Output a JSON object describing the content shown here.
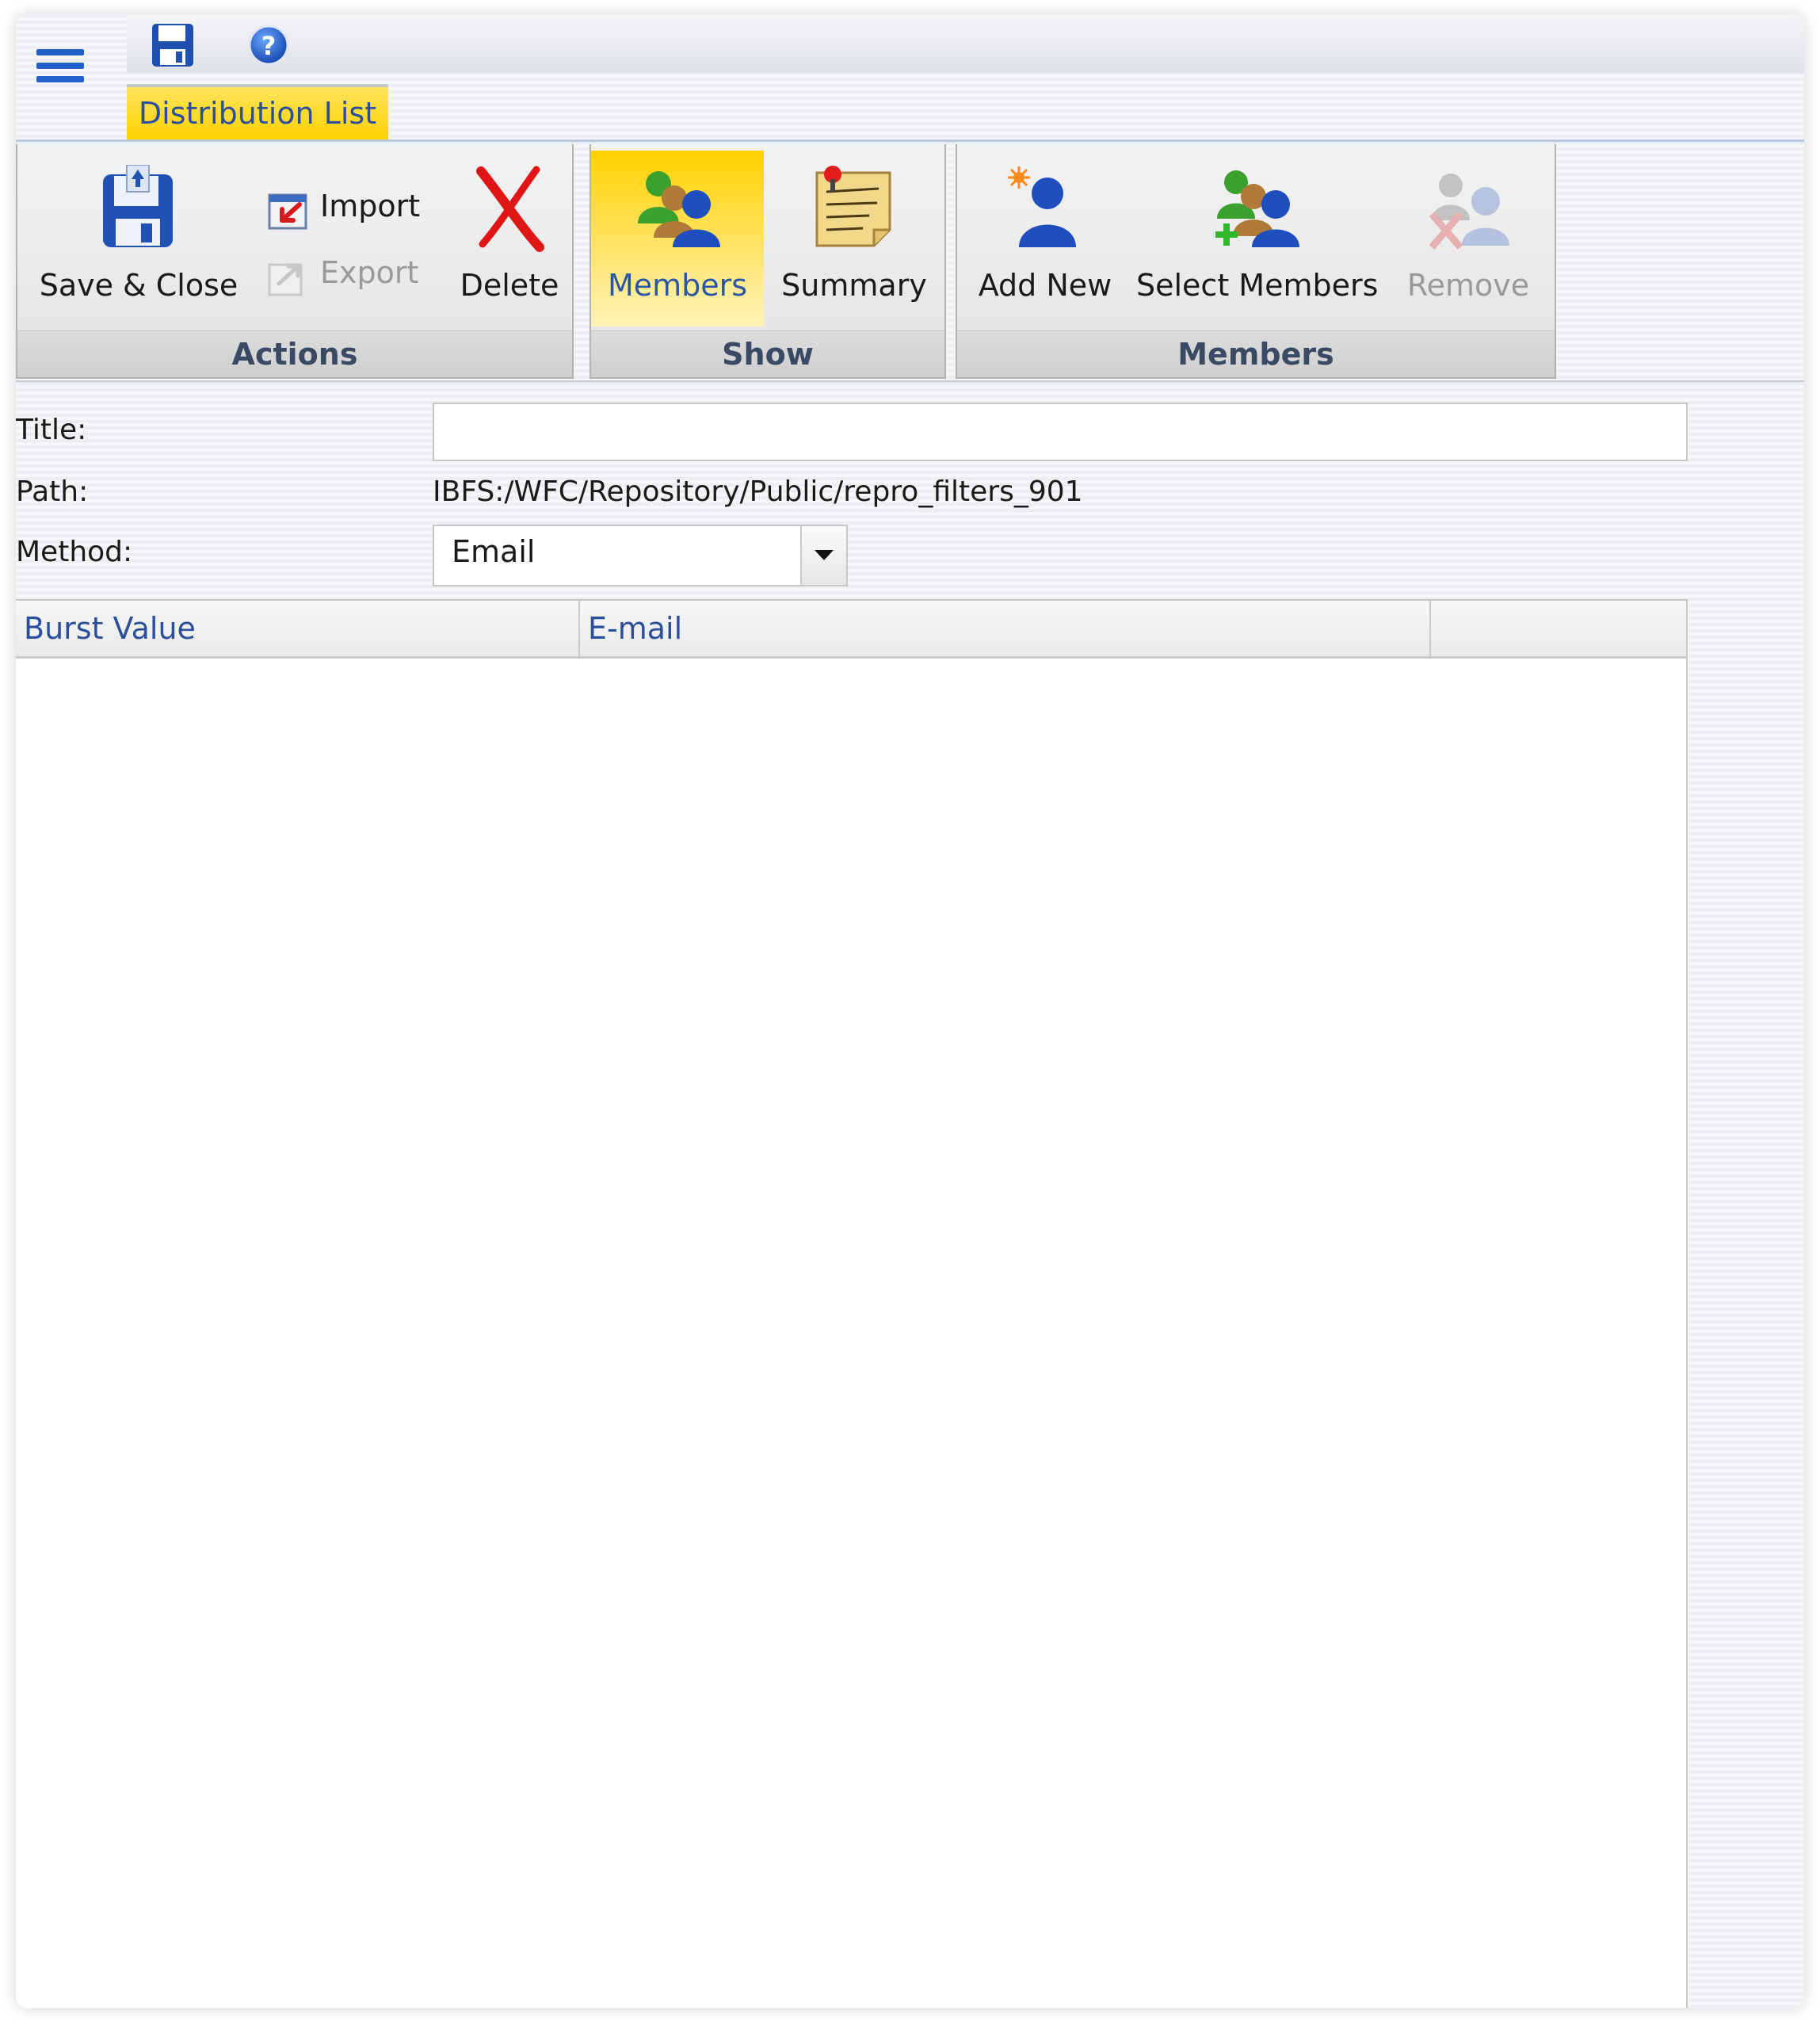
{
  "quick_access": {
    "save_icon": "floppy-disk-icon",
    "help_icon": "help-question-icon"
  },
  "tab": {
    "label": "Distribution List"
  },
  "ribbon": {
    "actions": {
      "group_label": "Actions",
      "save_close": "Save & Close",
      "import": "Import",
      "export": "Export",
      "delete": "Delete"
    },
    "show": {
      "group_label": "Show",
      "members": "Members",
      "summary": "Summary"
    },
    "members": {
      "group_label": "Members",
      "add_new": "Add New",
      "select_members": "Select Members",
      "remove": "Remove"
    }
  },
  "form": {
    "title_label": "Title:",
    "title_value": "",
    "path_label": "Path:",
    "path_value": "IBFS:/WFC/Repository/Public/repro_filters_901",
    "method_label": "Method:",
    "method_value": "Email"
  },
  "grid": {
    "columns": [
      "Burst Value",
      "E-mail",
      ""
    ],
    "rows": []
  },
  "colors": {
    "accent_yellow": "#ffd200",
    "accent_blue": "#2260c8",
    "label_blue": "#2b4f9a"
  }
}
